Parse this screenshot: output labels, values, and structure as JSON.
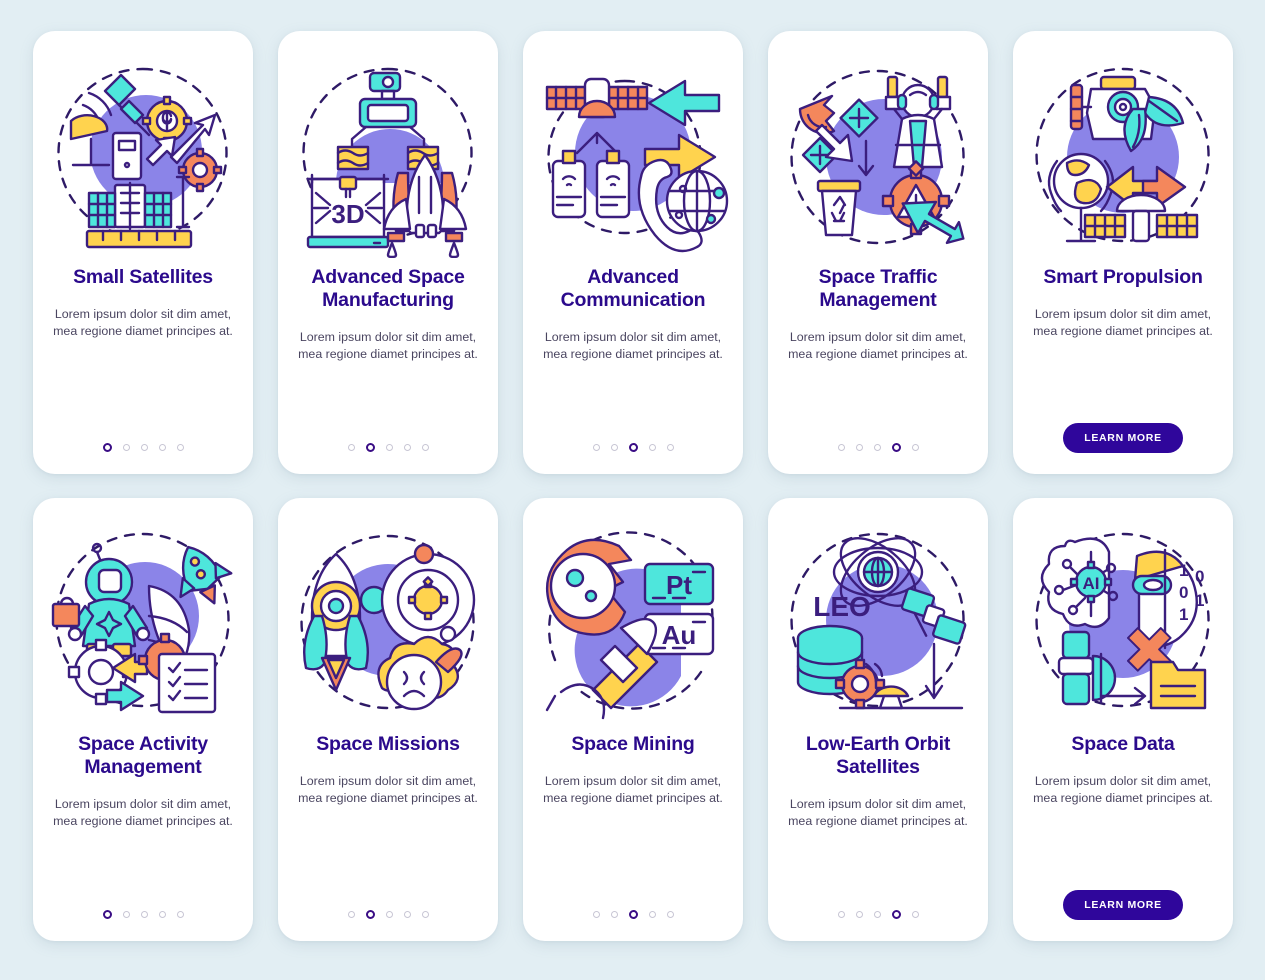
{
  "page": {
    "background_color": "#e2eef3",
    "card_background": "#ffffff",
    "title_color": "#2b0a8c",
    "body_color": "#4a4560",
    "accent_color": "#2f069b",
    "dot_inactive_color": "#c8c6d4",
    "dot_active_color": "#3a0d85"
  },
  "palette": {
    "outline": "#3b1e7e",
    "blob_purple": "#8b84e8",
    "cyan": "#4ee6dc",
    "orange": "#f4875c",
    "yellow": "#ffd34e"
  },
  "shared": {
    "body_text": "Lorem ipsum dolor sit dim amet, mea regione diamet principes at.",
    "learn_more_label": "LEARN MORE",
    "dot_count": 5
  },
  "cards": [
    {
      "id": "small-satellites",
      "title": "Small Satellites",
      "body": "Lorem ipsum dolor sit dim amet, mea regione diamet principes at.",
      "active_dot": 1,
      "has_button": false,
      "illustration": "small-satellites-illustration"
    },
    {
      "id": "advanced-space-manufacturing",
      "title": "Advanced Space Manufacturing",
      "body": "Lorem ipsum dolor sit dim amet, mea regione diamet principes at.",
      "active_dot": 2,
      "has_button": false,
      "illustration": "3d-printing-shuttle-illustration",
      "illustration_label": "3D"
    },
    {
      "id": "advanced-communication",
      "title": "Advanced Communication",
      "body": "Lorem ipsum dolor sit dim amet, mea regione diamet principes at.",
      "active_dot": 3,
      "has_button": false,
      "illustration": "satellite-phone-globe-illustration"
    },
    {
      "id": "space-traffic-management",
      "title": "Space Traffic Management",
      "body": "Lorem ipsum dolor sit dim amet, mea regione diamet principes at.",
      "active_dot": 4,
      "has_button": false,
      "illustration": "debris-worker-warning-illustration"
    },
    {
      "id": "smart-propulsion",
      "title": "Smart Propulsion",
      "body": "Lorem ipsum dolor sit dim amet, mea regione diamet principes at.",
      "active_dot": 0,
      "has_button": true,
      "button_label": "LEARN MORE",
      "illustration": "eco-engine-earth-satellite-illustration"
    },
    {
      "id": "space-activity-management",
      "title": "Space Activity Management",
      "body": "Lorem ipsum dolor sit dim amet, mea regione diamet principes at.",
      "active_dot": 1,
      "has_button": false,
      "illustration": "astronaut-checklist-gears-illustration"
    },
    {
      "id": "space-missions",
      "title": "Space Missions",
      "body": "Lorem ipsum dolor sit dim amet, mea regione diamet principes at.",
      "active_dot": 2,
      "has_button": false,
      "illustration": "rocket-orbit-planet-illustration"
    },
    {
      "id": "space-mining",
      "title": "Space Mining",
      "body": "Lorem ipsum dolor sit dim amet, mea regione diamet principes at.",
      "active_dot": 3,
      "has_button": false,
      "illustration": "comet-pickaxe-elements-illustration",
      "illustration_labels": [
        "Pt",
        "Au"
      ]
    },
    {
      "id": "low-earth-orbit-satellites",
      "title": "Low-Earth Orbit Satellites",
      "body": "Lorem ipsum dolor sit dim amet, mea regione diamet principes at.",
      "active_dot": 4,
      "has_button": false,
      "illustration": "leo-database-satellite-illustration",
      "illustration_label": "LEO"
    },
    {
      "id": "space-data",
      "title": "Space Data",
      "body": "Lorem ipsum dolor sit dim amet, mea regione diamet principes at.",
      "active_dot": 0,
      "has_button": true,
      "button_label": "LEARN MORE",
      "illustration": "ai-brain-data-illustration",
      "illustration_label": "AI"
    }
  ]
}
